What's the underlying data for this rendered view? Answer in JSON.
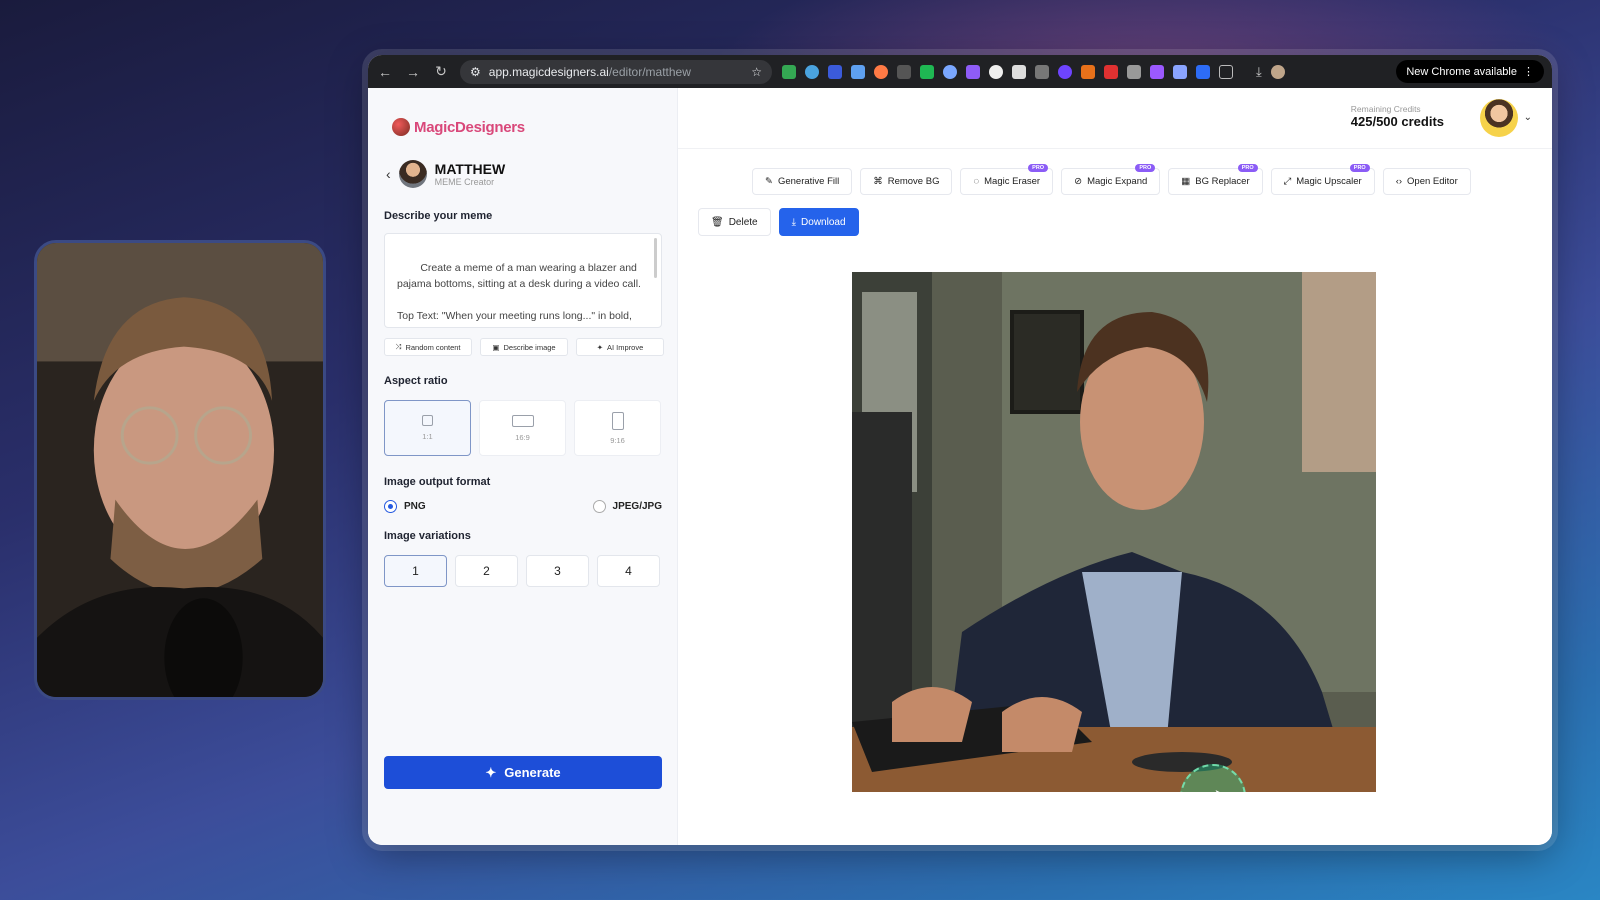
{
  "browser": {
    "url_host": "app.magicdesigners.ai",
    "url_path": "/editor/matthew",
    "new_chrome_label": "New Chrome available"
  },
  "brand": {
    "part1": "Magic",
    "part2": "Designers"
  },
  "profile": {
    "name": "MATTHEW",
    "role": "MEME Creator"
  },
  "prompt": {
    "label": "Describe your meme",
    "text": "Create a meme of a man wearing a blazer and pajama bottoms, sitting at a desk during a video call.\n\nTop Text: \"When your meeting runs long...\" in bold, italic Arial Black font, centered at the top"
  },
  "prompt_actions": [
    "Random content",
    "Describe image",
    "AI Improve"
  ],
  "aspect": {
    "label": "Aspect ratio",
    "options": [
      "1:1",
      "16:9",
      "9:16"
    ],
    "selected": "1:1"
  },
  "format": {
    "label": "Image output format",
    "options": [
      "PNG",
      "JPEG/JPG"
    ],
    "selected": "PNG"
  },
  "variations": {
    "label": "Image variations",
    "options": [
      "1",
      "2",
      "3",
      "4"
    ],
    "selected": "1"
  },
  "generate_label": "Generate",
  "credits": {
    "label": "Remaining Credits",
    "value": "425/500 credits"
  },
  "tools": [
    {
      "label": "Generative Fill",
      "icon": "wand-icon",
      "pro": false
    },
    {
      "label": "Remove BG",
      "icon": "remove-bg-icon",
      "pro": false
    },
    {
      "label": "Magic Eraser",
      "icon": "eraser-icon",
      "pro": true
    },
    {
      "label": "Magic Expand",
      "icon": "expand-icon",
      "pro": true
    },
    {
      "label": "BG Replacer",
      "icon": "bg-replace-icon",
      "pro": true
    },
    {
      "label": "Magic Upscaler",
      "icon": "upscale-icon",
      "pro": true
    },
    {
      "label": "Open Editor",
      "icon": "code-icon",
      "pro": false
    }
  ],
  "pro_badge": "PRO",
  "actions": {
    "delete": "Delete",
    "download": "Download"
  }
}
